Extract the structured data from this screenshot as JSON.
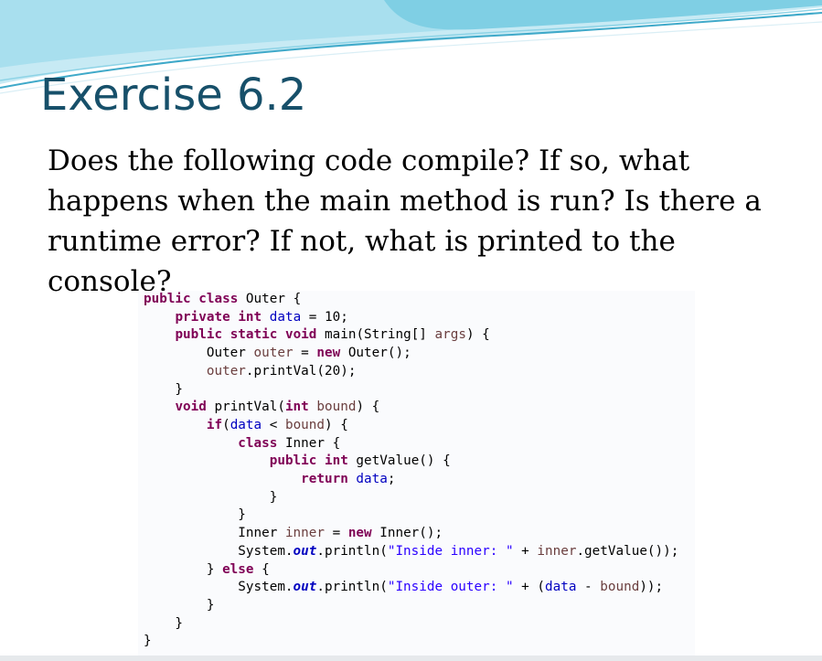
{
  "slide": {
    "title": "Exercise 6.2",
    "question": "Does the following code compile? If so, what happens when the main method is run? Is there a runtime error? If not, what is printed to the console?"
  },
  "code": {
    "language": "java",
    "lines": [
      "public class Outer {",
      "    private int data = 10;",
      "    public static void main(String[] args) {",
      "        Outer outer = new Outer();",
      "        outer.printVal(20);",
      "    }",
      "    void printVal(int bound) {",
      "        if(data < bound) {",
      "            class Inner {",
      "                public int getValue() {",
      "                    return data;",
      "                }",
      "            }",
      "            Inner inner = new Inner();",
      "            System.out.println(\"Inside inner: \" + inner.getValue());",
      "        } else {",
      "            System.out.println(\"Inside outer: \" + (data - bound));",
      "        }",
      "    }",
      "}"
    ]
  },
  "colors": {
    "title": "#17506a",
    "keyword": "#7f0055",
    "field": "#0000c0",
    "variable": "#6a3e3e",
    "string": "#2a00ff",
    "wave_light": "#bfe6f2",
    "wave_dark": "#5cc0d8"
  }
}
